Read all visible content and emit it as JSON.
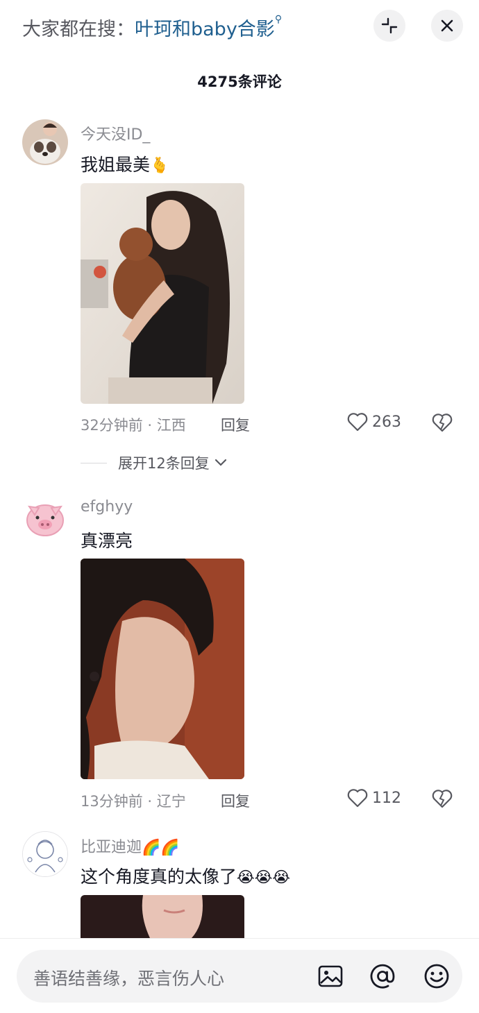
{
  "header": {
    "search_prefix": "大家都在搜：",
    "search_term": "叶珂和baby合影",
    "search_glyph": "⚲"
  },
  "comments_count": "4275条评论",
  "comments": [
    {
      "username": "今天没ID_",
      "text": "我姐最美",
      "text_emoji": "🫰",
      "time_location": "32分钟前 · 江西",
      "reply_label": "回复",
      "likes": "263",
      "expand_replies": "展开12条回复"
    },
    {
      "username": "efghyy",
      "text": "真漂亮",
      "time_location": "13分钟前 · 辽宁",
      "reply_label": "回复",
      "likes": "112"
    },
    {
      "username": "比亚迪迦",
      "username_emoji": "🌈🌈",
      "text": "这个角度真的太像了",
      "text_emoji": "😭😭😭"
    }
  ],
  "input": {
    "placeholder": "善语结善缘，恶言伤人心"
  },
  "icons": [
    "minimize-icon",
    "close-icon",
    "heart-icon",
    "dislike-icon",
    "chevron-down-icon",
    "image-icon",
    "mention-icon",
    "emoji-icon"
  ],
  "colors": {
    "accent_link": "#1f5f8f",
    "muted_text": "#8a8b91",
    "input_bg": "#f3f3f4"
  }
}
